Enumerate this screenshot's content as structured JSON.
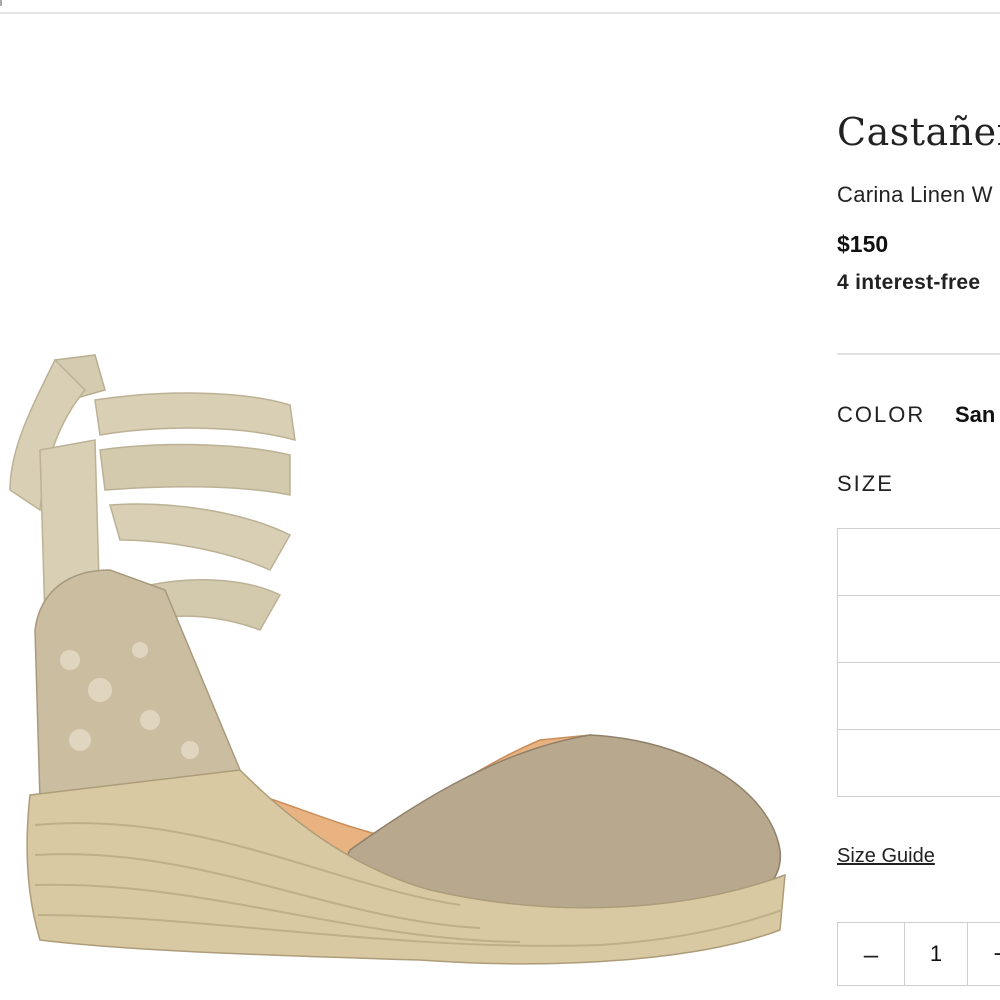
{
  "product": {
    "brand": "Castañer",
    "name": "Carina Linen W",
    "price": "$150",
    "installments": "4 interest-free",
    "color_label": "COLOR",
    "color_value": "San",
    "size_label": "SIZE",
    "size_options": [
      "",
      "",
      "",
      ""
    ],
    "size_guide": "Size Guide",
    "quantity": {
      "minus": "–",
      "value": "1",
      "plus": "+"
    }
  },
  "image": {
    "icon": "espadrille-wedge-sandal",
    "colors": {
      "canvas": "#b8a88e",
      "ribbon": "#d8cfb4",
      "jute": "#d9c9a3",
      "lining": "#e8b381"
    }
  }
}
